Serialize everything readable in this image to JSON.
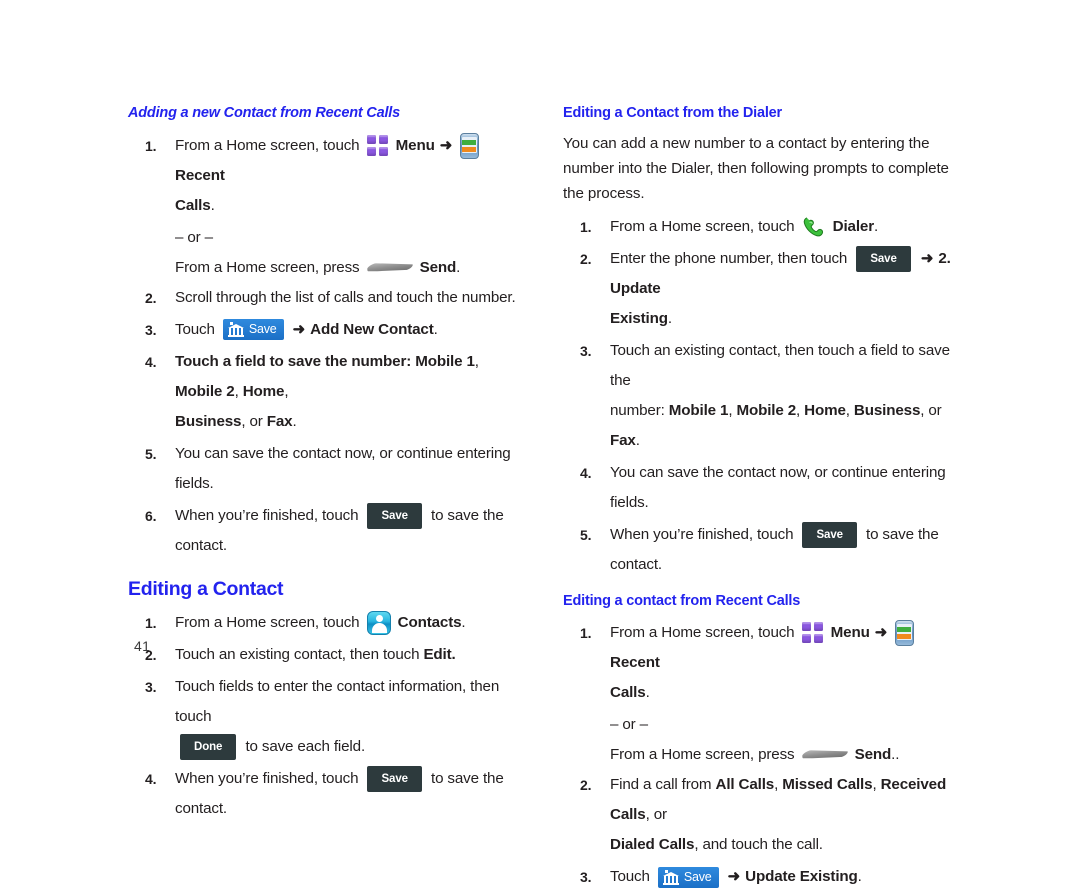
{
  "page": {
    "number": "41",
    "heading_color": "#2323ee",
    "blue_button_color": "#1f78d1",
    "dark_button_color": "#2d3a3d"
  },
  "icons": {
    "menu": "menu-grid-icon",
    "recent_calls": "recent-calls-phone-icon",
    "send_key": "send-hardware-key-icon",
    "save_blue": "save-bank-icon",
    "contacts": "contacts-person-icon",
    "dialer": "dialer-handset-icon"
  },
  "labels": {
    "arrow": "➜",
    "or": "– or –",
    "save_blue_text": "Save",
    "save_dark_text": "Save",
    "done_dark_text": "Done"
  },
  "left_column": {
    "section1": {
      "heading": "Adding a new Contact from Recent Calls",
      "steps": {
        "s1_num": "1.",
        "s1_a": "From a Home screen, touch",
        "s1_menu": "Menu",
        "s1_recent": "Recent",
        "s1_calls": "Calls",
        "s1_period": ".",
        "s1_or": "– or –",
        "s1_b": "From a Home screen, press",
        "s1_send": "Send",
        "s1_send_period": ".",
        "s2_num": "2.",
        "s2_text": "Scroll through the list of calls and touch the number.",
        "s3_num": "3.",
        "s3_touch": "Touch",
        "s3_target": "Add New Contact",
        "s3_period": ".",
        "s4_num": "4.",
        "s4_a": "Touch a field to save the number:",
        "s4_m1": "Mobile 1",
        "s4_m2": "Mobile 2",
        "s4_home": "Home",
        "s4_business": "Business",
        "s4_or": ", or",
        "s4_fax": "Fax",
        "s4_period": ".",
        "s5_num": "5.",
        "s5_text": "You can save the contact now, or continue entering fields.",
        "s6_num": "6.",
        "s6_a": "When you’re finished, touch",
        "s6_b": "to save the contact."
      }
    },
    "section2": {
      "heading": "Editing a Contact",
      "steps": {
        "s1_num": "1.",
        "s1_a": "From a Home screen, touch",
        "s1_contacts": "Contacts",
        "s1_period": ".",
        "s2_num": "2.",
        "s2_a": "Touch an existing contact, then touch",
        "s2_edit": "Edit.",
        "s3_num": "3.",
        "s3_a": "Touch fields to enter the contact information, then touch",
        "s3_b": "to save each field.",
        "s4_num": "4.",
        "s4_a": "When you’re finished, touch",
        "s4_b": "to save the contact."
      }
    }
  },
  "right_column": {
    "section1": {
      "heading": "Editing a Contact from the Dialer",
      "intro": "You can add a new number to a contact by entering the number into the Dialer, then following prompts to complete the process.",
      "steps": {
        "s1_num": "1.",
        "s1_a": "From a Home screen, touch",
        "s1_dialer": "Dialer",
        "s1_period": ".",
        "s2_num": "2.",
        "s2_a": "Enter the phone number, then touch",
        "s2_update": "2. Update",
        "s2_existing": "Existing",
        "s2_period": ".",
        "s3_num": "3.",
        "s3_a": "Touch an existing contact, then touch a field to save the",
        "s3_b": "number:",
        "s3_m1": "Mobile 1",
        "s3_m2": "Mobile 2",
        "s3_home": "Home",
        "s3_business": "Business",
        "s3_or": ", or",
        "s3_fax": "Fax",
        "s3_period": ".",
        "s4_num": "4.",
        "s4_text": "You can save the contact now, or continue entering fields.",
        "s5_num": "5.",
        "s5_a": "When you’re finished, touch",
        "s5_b": "to save the contact."
      }
    },
    "section2": {
      "heading": "Editing a contact from Recent Calls",
      "steps": {
        "s1_num": "1.",
        "s1_a": "From a Home screen, touch",
        "s1_menu": "Menu",
        "s1_recent": "Recent",
        "s1_calls": "Calls",
        "s1_period": ".",
        "s1_or": "– or –",
        "s1_b": "From a Home screen, press",
        "s1_send": "Send",
        "s1_send_period": "..",
        "s2_num": "2.",
        "s2_a": "Find a call from",
        "s2_all": "All Calls",
        "s2_missed": "Missed Calls",
        "s2_received": "Received Calls",
        "s2_or": ", or",
        "s2_dialed": "Dialed Calls",
        "s2_b": ", and touch the call.",
        "s3_num": "3.",
        "s3_touch": "Touch",
        "s3_target": "Update Existing",
        "s3_period": "."
      }
    }
  }
}
